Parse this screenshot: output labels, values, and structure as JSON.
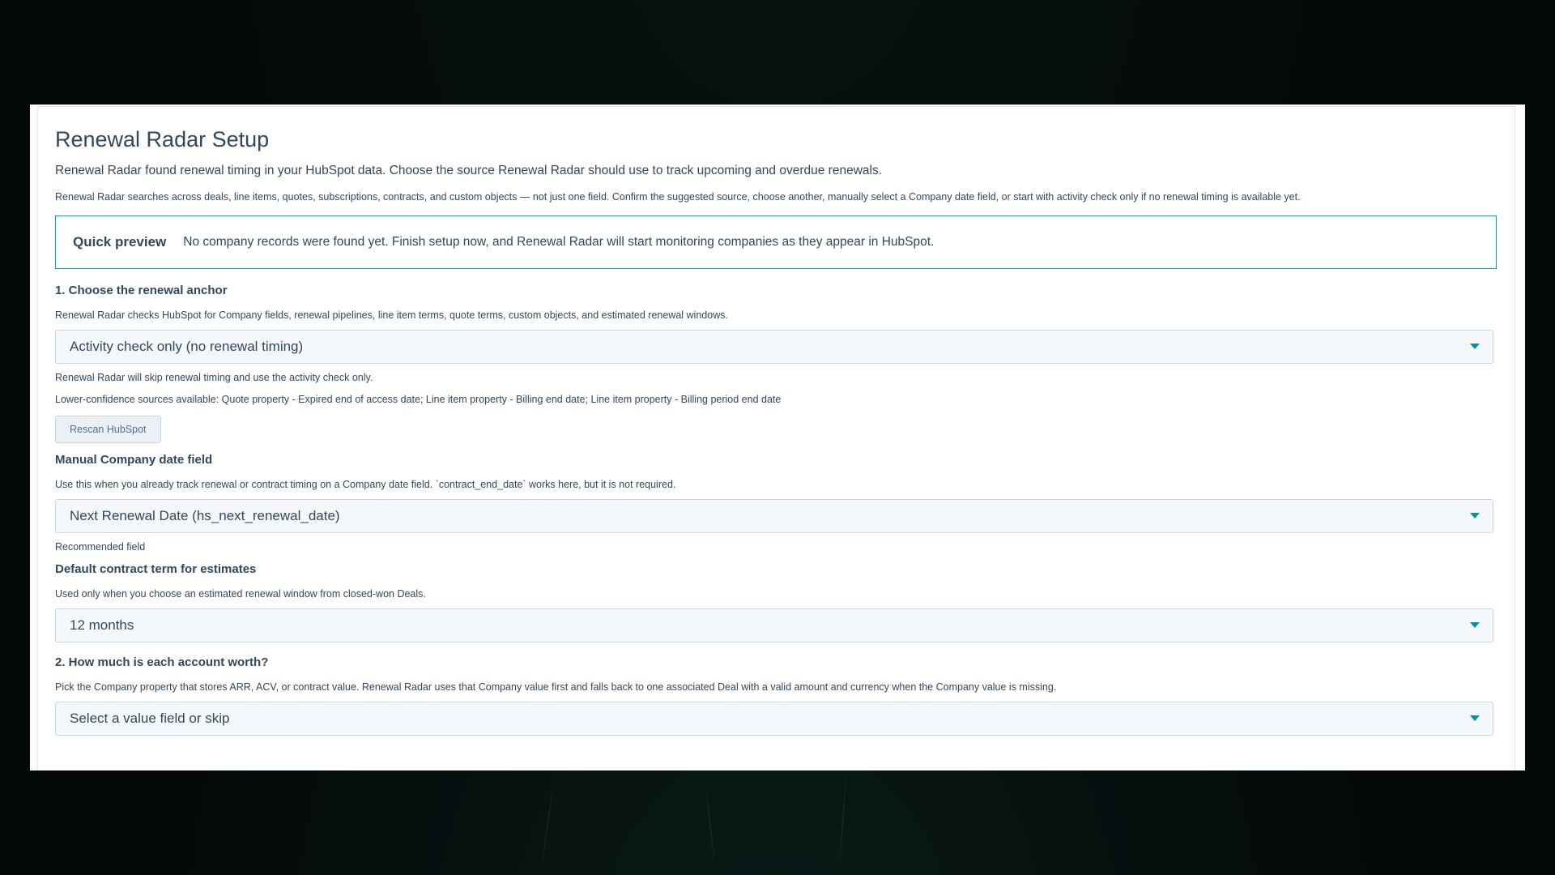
{
  "page": {
    "title": "Renewal Radar Setup",
    "lead": "Renewal Radar found renewal timing in your HubSpot data. Choose the source Renewal Radar should use to track upcoming and overdue renewals.",
    "description": "Renewal Radar searches across deals, line items, quotes, subscriptions, contracts, and custom objects — not just one field. Confirm the suggested source, choose another, manually select a Company date field, or start with activity check only if no renewal timing is available yet."
  },
  "preview": {
    "label": "Quick preview",
    "text": "No company records were found yet. Finish setup now, and Renewal Radar will start monitoring companies as they appear in HubSpot."
  },
  "anchor": {
    "heading": "1. Choose the renewal anchor",
    "help": "Renewal Radar checks HubSpot for Company fields, renewal pipelines, line item terms, quote terms, custom objects, and estimated renewal windows.",
    "selected": "Activity check only (no renewal timing)",
    "note": "Renewal Radar will skip renewal timing and use the activity check only.",
    "lower_confidence": "Lower-confidence sources available: Quote property - Expired end of access date; Line item property - Billing end date; Line item property - Billing period end date",
    "rescan_label": "Rescan HubSpot"
  },
  "manual_field": {
    "heading": "Manual Company date field",
    "help": "Use this when you already track renewal or contract timing on a Company date field. `contract_end_date` works here, but it is not required.",
    "selected": "Next Renewal Date (hs_next_renewal_date)",
    "note": "Recommended field"
  },
  "contract_term": {
    "heading": "Default contract term for estimates",
    "help": "Used only when you choose an estimated renewal window from closed-won Deals.",
    "selected": "12 months"
  },
  "account_value": {
    "heading": "2. How much is each account worth?",
    "help": "Pick the Company property that stores ARR, ACV, or contract value. Renewal Radar uses that Company value first and falls back to one associated Deal with a valid amount and currency when the Company value is missing.",
    "selected": "Select a value field or skip"
  },
  "icons": {
    "dropdown": "chevron-down-icon"
  },
  "colors": {
    "text": "#33475b",
    "accent": "#00a4bd",
    "caret": "#0091ae",
    "field_bg": "#f5f8fa",
    "border": "#cbd6e2"
  }
}
